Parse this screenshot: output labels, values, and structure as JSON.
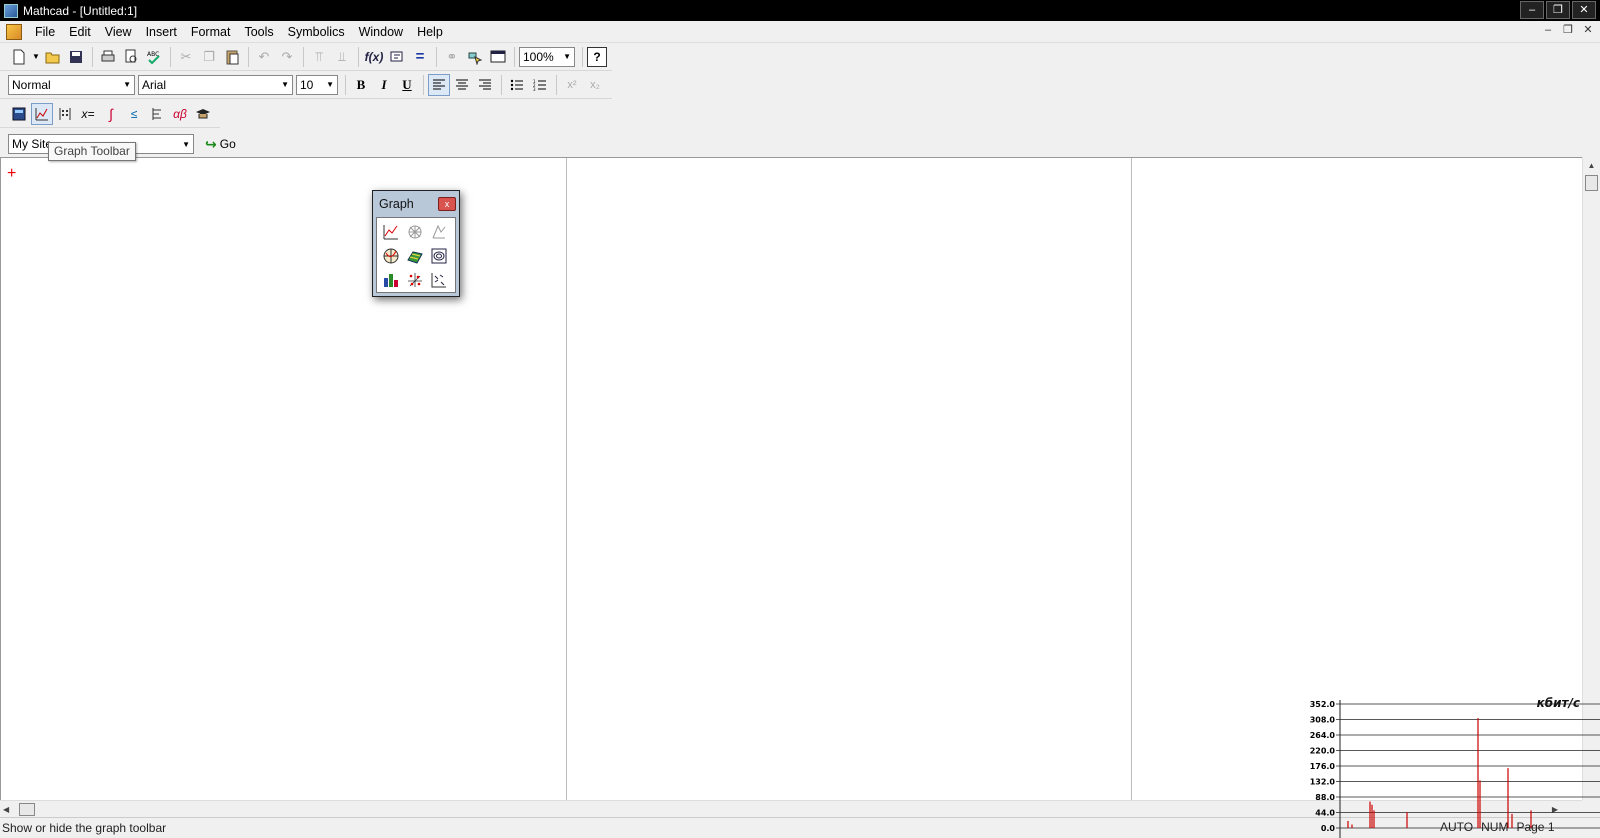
{
  "window": {
    "title": "Mathcad - [Untitled:1]"
  },
  "window_controls": [
    "–",
    "❐",
    "✕"
  ],
  "mdi_controls": [
    "–",
    "❐",
    "✕"
  ],
  "menu": [
    "File",
    "Edit",
    "View",
    "Insert",
    "Format",
    "Tools",
    "Symbolics",
    "Window",
    "Help"
  ],
  "toolbar": {
    "zoom": "100%",
    "help_glyph": "?"
  },
  "format_bar": {
    "style": "Normal",
    "font": "Arial",
    "size": "10",
    "bold": "B",
    "italic": "I",
    "underline": "U"
  },
  "resources_bar": {
    "site": "My Site",
    "go_label": "Go"
  },
  "tooltip": {
    "text": "Graph Toolbar"
  },
  "graph_palette": {
    "title": "Graph",
    "close": "x",
    "icons": [
      "xy-plot-icon",
      "polar-plot-icon",
      "surface-plot-icon",
      "polar-grid-icon",
      "3d-surface-icon",
      "contour-plot-icon",
      "bar-plot-icon",
      "scatter-plot-icon",
      "vector-field-icon"
    ]
  },
  "statusbar": {
    "message": "Show or hide the graph toolbar",
    "auto": "AUTO",
    "num": "NUM",
    "page": "Page 1"
  },
  "netgraph": {
    "unit": "кбит/с",
    "ticks": [
      "352.0",
      "308.0",
      "264.0",
      "220.0",
      "176.0",
      "132.0",
      "88.0",
      "44.0",
      "0.0"
    ],
    "ymax": 352
  },
  "colors": {
    "cursor": "#e00000",
    "netgraph_line": "#cc0000"
  }
}
